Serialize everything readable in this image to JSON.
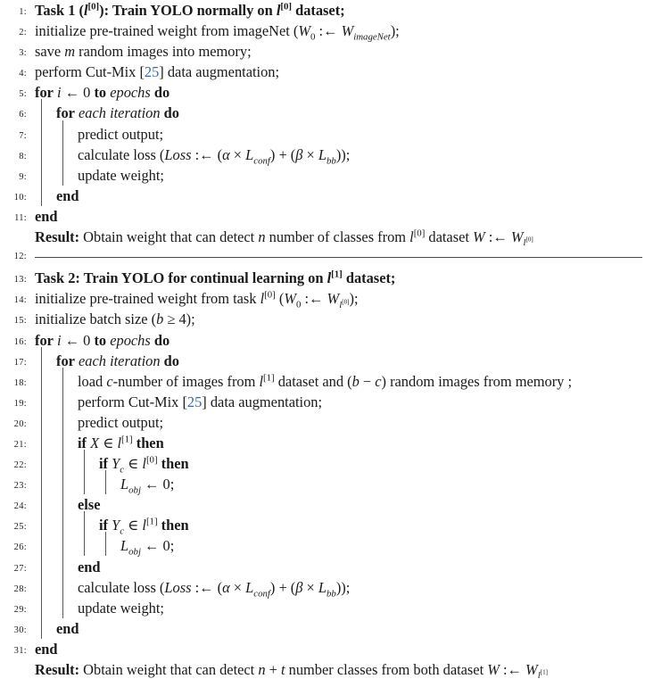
{
  "document": {
    "type": "algorithm-pseudocode",
    "style": "ruled",
    "accent_citation_color": "#2c6eb5",
    "rule_color": "#4a4a4a",
    "text_color": "#1a1a1a"
  },
  "lines": [
    {
      "no": "1:",
      "indent": 0,
      "bars": []
    },
    {
      "no": "2:",
      "indent": 0,
      "bars": []
    },
    {
      "no": "3:",
      "indent": 0,
      "bars": []
    },
    {
      "no": "4:",
      "indent": 0,
      "bars": []
    },
    {
      "no": "5:",
      "indent": 0,
      "bars": []
    },
    {
      "no": "6:",
      "indent": 1,
      "bars": [
        1
      ]
    },
    {
      "no": "7:",
      "indent": 2,
      "bars": [
        1,
        2
      ]
    },
    {
      "no": "8:",
      "indent": 2,
      "bars": [
        1,
        2
      ]
    },
    {
      "no": "9:",
      "indent": 2,
      "bars": [
        1,
        2
      ]
    },
    {
      "no": "10:",
      "indent": 1,
      "bars": [
        1
      ]
    },
    {
      "no": "11:",
      "indent": 0,
      "bars": []
    },
    {
      "no": "",
      "indent": 0,
      "bars": []
    },
    {
      "no": "12:",
      "indent": 0,
      "bars": []
    },
    {
      "no": "13:",
      "indent": 0,
      "bars": []
    },
    {
      "no": "14:",
      "indent": 0,
      "bars": []
    },
    {
      "no": "15:",
      "indent": 0,
      "bars": []
    },
    {
      "no": "16:",
      "indent": 0,
      "bars": []
    },
    {
      "no": "17:",
      "indent": 1,
      "bars": [
        1
      ]
    },
    {
      "no": "18:",
      "indent": 2,
      "bars": [
        1,
        2
      ]
    },
    {
      "no": "19:",
      "indent": 2,
      "bars": [
        1,
        2
      ]
    },
    {
      "no": "20:",
      "indent": 2,
      "bars": [
        1,
        2
      ]
    },
    {
      "no": "21:",
      "indent": 2,
      "bars": [
        1,
        2
      ]
    },
    {
      "no": "22:",
      "indent": 3,
      "bars": [
        1,
        2,
        3
      ]
    },
    {
      "no": "23:",
      "indent": 4,
      "bars": [
        1,
        2,
        3,
        4
      ]
    },
    {
      "no": "24:",
      "indent": 2,
      "bars": [
        1,
        2
      ]
    },
    {
      "no": "25:",
      "indent": 3,
      "bars": [
        1,
        2,
        3
      ]
    },
    {
      "no": "26:",
      "indent": 4,
      "bars": [
        1,
        2,
        3,
        4
      ]
    },
    {
      "no": "27:",
      "indent": 2,
      "bars": [
        1,
        2
      ]
    },
    {
      "no": "28:",
      "indent": 2,
      "bars": [
        1,
        2
      ]
    },
    {
      "no": "29:",
      "indent": 2,
      "bars": [
        1,
        2
      ]
    },
    {
      "no": "30:",
      "indent": 1,
      "bars": [
        1
      ]
    },
    {
      "no": "31:",
      "indent": 0,
      "bars": []
    },
    {
      "no": "",
      "indent": 0,
      "bars": []
    }
  ],
  "text": {
    "line1_task": "Task 1 (",
    "line1_l": "l",
    "line1_sup": "[0]",
    "line1_mid": "): Train YOLO normally on ",
    "line1_l2": "l",
    "line1_sup2": "[0]",
    "line1_end": " dataset;",
    "line2_a": "initialize pre-trained weight from imageNet (",
    "line2_W": "W",
    "line2_Wsub": "0",
    "line2_arrow": " :← ",
    "line2_W2": "W",
    "line2_W2sub": "imageNet",
    "line2_end": ");",
    "line3_a": "save ",
    "line3_m": "m",
    "line3_b": " random images into memory;",
    "line4_a": "perform Cut-Mix [",
    "line4_cite": "25",
    "line4_b": "] data augmentation;",
    "line5_for": "for",
    "line5_i": " i ",
    "line5_arrow": "← 0 ",
    "line5_to": "to",
    "line5_epochs": " epochs ",
    "line5_do": "do",
    "line6_for": "for",
    "line6_each": " each iteration ",
    "line6_do": "do",
    "line7": "predict output;",
    "line8_a": "calculate loss (",
    "line8_loss": "Loss",
    "line8_arrow": " :← (",
    "line8_alpha": "α",
    "line8_times1": " × ",
    "line8_L1": "L",
    "line8_L1sub": "conf",
    "line8_plus": ") + (",
    "line8_beta": "β",
    "line8_times2": " × ",
    "line8_L2": "L",
    "line8_L2sub": "bb",
    "line8_end": "));",
    "line9": "update weight;",
    "line10_end": "end",
    "line11_end": "end",
    "result1_label": "Result:",
    "result1_a": " Obtain weight that can detect ",
    "result1_n": "n",
    "result1_b": " number of classes from ",
    "result1_l": "l",
    "result1_lsup": "[0]",
    "result1_c": " dataset ",
    "result1_W": "W",
    "result1_arrow": " :← ",
    "result1_W2": "W",
    "result1_W2sub_l": "l",
    "result1_W2sub_sup": "[0]",
    "line13_task": "Task 2: Train YOLO for continual learning on ",
    "line13_l": "l",
    "line13_sup": "[1]",
    "line13_end": " dataset;",
    "line14_a": "initialize pre-trained weight from task ",
    "line14_l": "l",
    "line14_lsup": "[0]",
    "line14_b": " (",
    "line14_W": "W",
    "line14_Wsub": "0",
    "line14_arrow": " :← ",
    "line14_W2": "W",
    "line14_W2sub_l": "l",
    "line14_W2sub_sup": "[0]",
    "line14_end": ");",
    "line15_a": "initialize batch size (",
    "line15_b": "b",
    "line15_ge": " ≥ 4);",
    "line16_for": "for",
    "line16_i": " i ",
    "line16_arrow": "← 0 ",
    "line16_to": "to",
    "line16_epochs": " epochs ",
    "line16_do": "do",
    "line17_for": "for",
    "line17_each": " each iteration ",
    "line17_do": "do",
    "line18_a": "load ",
    "line18_c": "c",
    "line18_b": "-number of images from ",
    "line18_l": "l",
    "line18_lsup": "[1]",
    "line18_c2": " dataset and (",
    "line18_bvar": "b",
    "line18_minus": " − ",
    "line18_cvar": "c",
    "line18_end": ") random images from memory ;",
    "line19_a": "perform Cut-Mix [",
    "line19_cite": "25",
    "line19_b": "] data augmentation;",
    "line20": "predict output;",
    "line21_if": "if",
    "line21_X": " X ",
    "line21_in": "∈ ",
    "line21_l": "l",
    "line21_lsup": "[1]",
    "line21_then": " then",
    "line22_if": "if",
    "line22_Y": " Y",
    "line22_Ysub": "c",
    "line22_in": " ∈ ",
    "line22_l": "l",
    "line22_lsup": "[0]",
    "line22_then": " then",
    "line23_L": "L",
    "line23_Lsub": "obj",
    "line23_arrow": " ← 0;",
    "line24_else": "else",
    "line25_if": "if",
    "line25_Y": " Y",
    "line25_Ysub": "c",
    "line25_in": " ∈ ",
    "line25_l": "l",
    "line25_lsup": "[1]",
    "line25_then": " then",
    "line26_L": "L",
    "line26_Lsub": "obj",
    "line26_arrow": " ← 0;",
    "line27_end": "end",
    "line28_a": "calculate loss (",
    "line28_loss": "Loss",
    "line28_arrow": " :← (",
    "line28_alpha": "α",
    "line28_times1": " × ",
    "line28_L1": "L",
    "line28_L1sub": "conf",
    "line28_plus": ") + (",
    "line28_beta": "β",
    "line28_times2": " × ",
    "line28_L2": "L",
    "line28_L2sub": "bb",
    "line28_end": "));",
    "line29": "update weight;",
    "line30_end": "end",
    "line31_end": "end",
    "result2_label": "Result:",
    "result2_a": " Obtain weight that can detect ",
    "result2_n": "n",
    "result2_plus": " + ",
    "result2_t": "t",
    "result2_b": " number classes from both dataset ",
    "result2_W": "W",
    "result2_arrow": " :← ",
    "result2_W2": "W",
    "result2_W2sub_l": "l",
    "result2_W2sub_sup": "[1]"
  }
}
